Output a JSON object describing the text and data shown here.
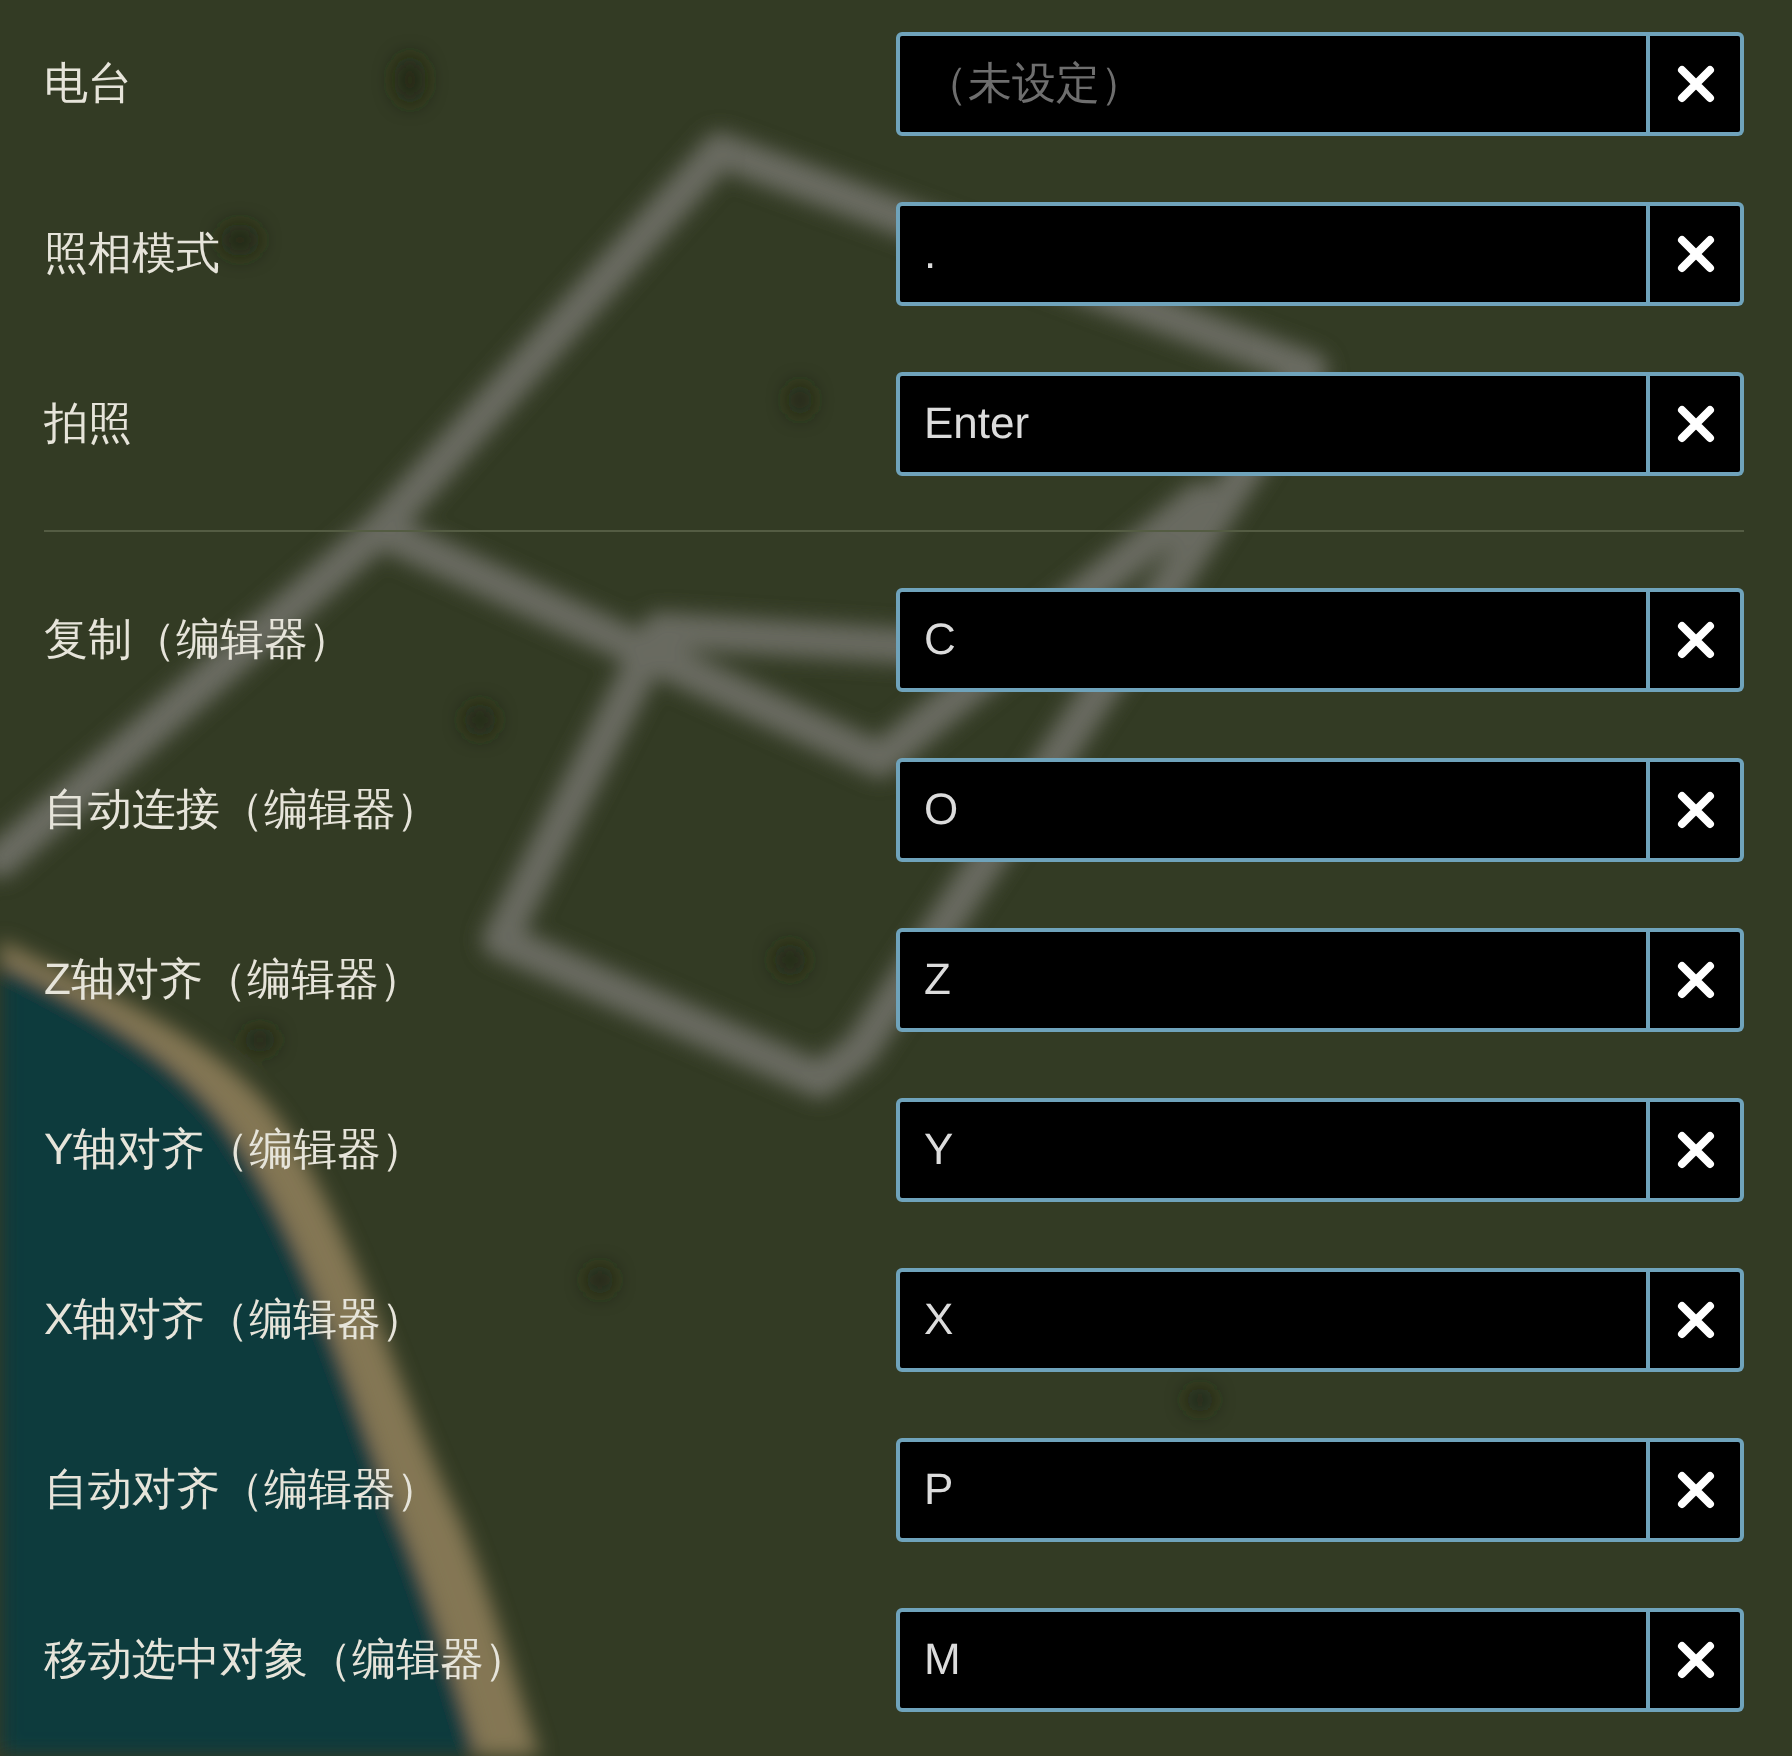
{
  "sections": [
    {
      "bindings": [
        {
          "label": "电台",
          "placeholder": "（未设定）"
        },
        {
          "label": "照相模式",
          "value": "."
        },
        {
          "label": "拍照",
          "value": "Enter"
        }
      ]
    },
    {
      "bindings": [
        {
          "label": "复制（编辑器）",
          "value": "C"
        },
        {
          "label": "自动连接（编辑器）",
          "value": "O"
        },
        {
          "label": "Z轴对齐（编辑器）",
          "value": "Z"
        },
        {
          "label": "Y轴对齐（编辑器）",
          "value": "Y"
        },
        {
          "label": "X轴对齐（编辑器）",
          "value": "X"
        },
        {
          "label": "自动对齐（编辑器）",
          "value": "P"
        },
        {
          "label": "移动选中对象（编辑器）",
          "value": "M"
        }
      ]
    }
  ]
}
